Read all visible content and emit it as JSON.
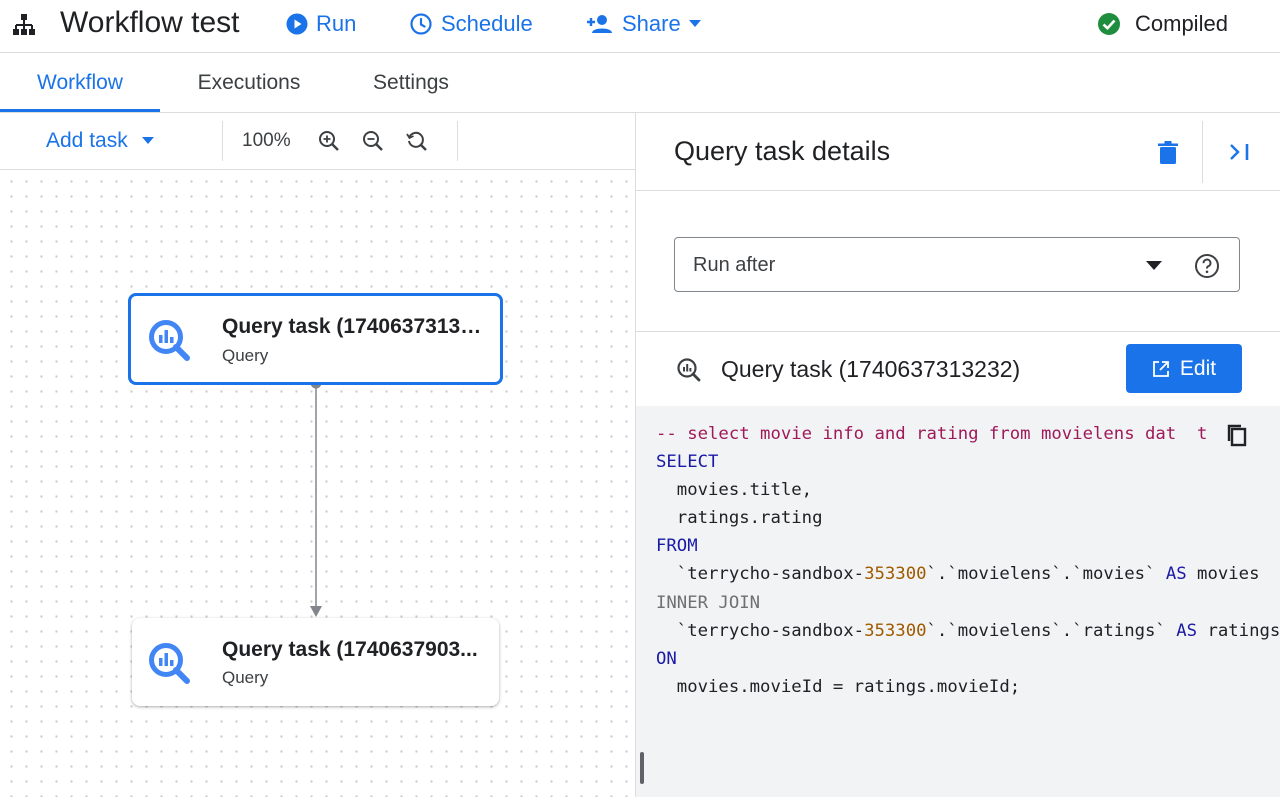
{
  "header": {
    "title": "Workflow test",
    "run_label": "Run",
    "schedule_label": "Schedule",
    "share_label": "Share",
    "status_label": "Compiled"
  },
  "tabs": [
    {
      "label": "Workflow",
      "active": true
    },
    {
      "label": "Executions",
      "active": false
    },
    {
      "label": "Settings",
      "active": false
    }
  ],
  "toolbar": {
    "add_task_label": "Add task",
    "zoom_level": "100%"
  },
  "nodes": [
    {
      "title": "Query task (1740637313232)",
      "type": "Query",
      "selected": true
    },
    {
      "title": "Query task (1740637903...",
      "type": "Query",
      "selected": false
    }
  ],
  "details": {
    "title": "Query task details",
    "run_after_label": "Run after",
    "task_name": "Query task (1740637313232)",
    "edit_label": "Edit"
  },
  "code": {
    "comment": "-- select movie info and rating from movielens dat",
    "comment_tail": "t",
    "select": "SELECT",
    "col1": "  movies.title,",
    "col2": "  ratings.rating",
    "from": "FROM",
    "from_pre": "  `terrycho-sandbox-",
    "from_num": "353300",
    "from_post": "`.`movielens`.`movies` ",
    "from_as": "AS",
    "from_alias": " movies",
    "join": "INNER JOIN",
    "join_pre": "  `terrycho-sandbox-",
    "join_num": "353300",
    "join_post": "`.`movielens`.`ratings` ",
    "join_as": "AS",
    "join_alias": " ratings",
    "on": "ON",
    "on_expr": "  movies.movieId = ratings.movieId;"
  },
  "colors": {
    "accent": "#1a73e8",
    "status_ok": "#1e8e3e",
    "code_bg": "#f1f3f4"
  },
  "icons": [
    "workflow-icon",
    "play-icon",
    "clock-icon",
    "person-add-icon",
    "check-circle-icon",
    "zoom-in-icon",
    "zoom-out-icon",
    "zoom-reset-icon",
    "bigquery-icon",
    "delete-icon",
    "collapse-panel-icon",
    "help-icon",
    "open-in-new-icon",
    "copy-icon"
  ]
}
